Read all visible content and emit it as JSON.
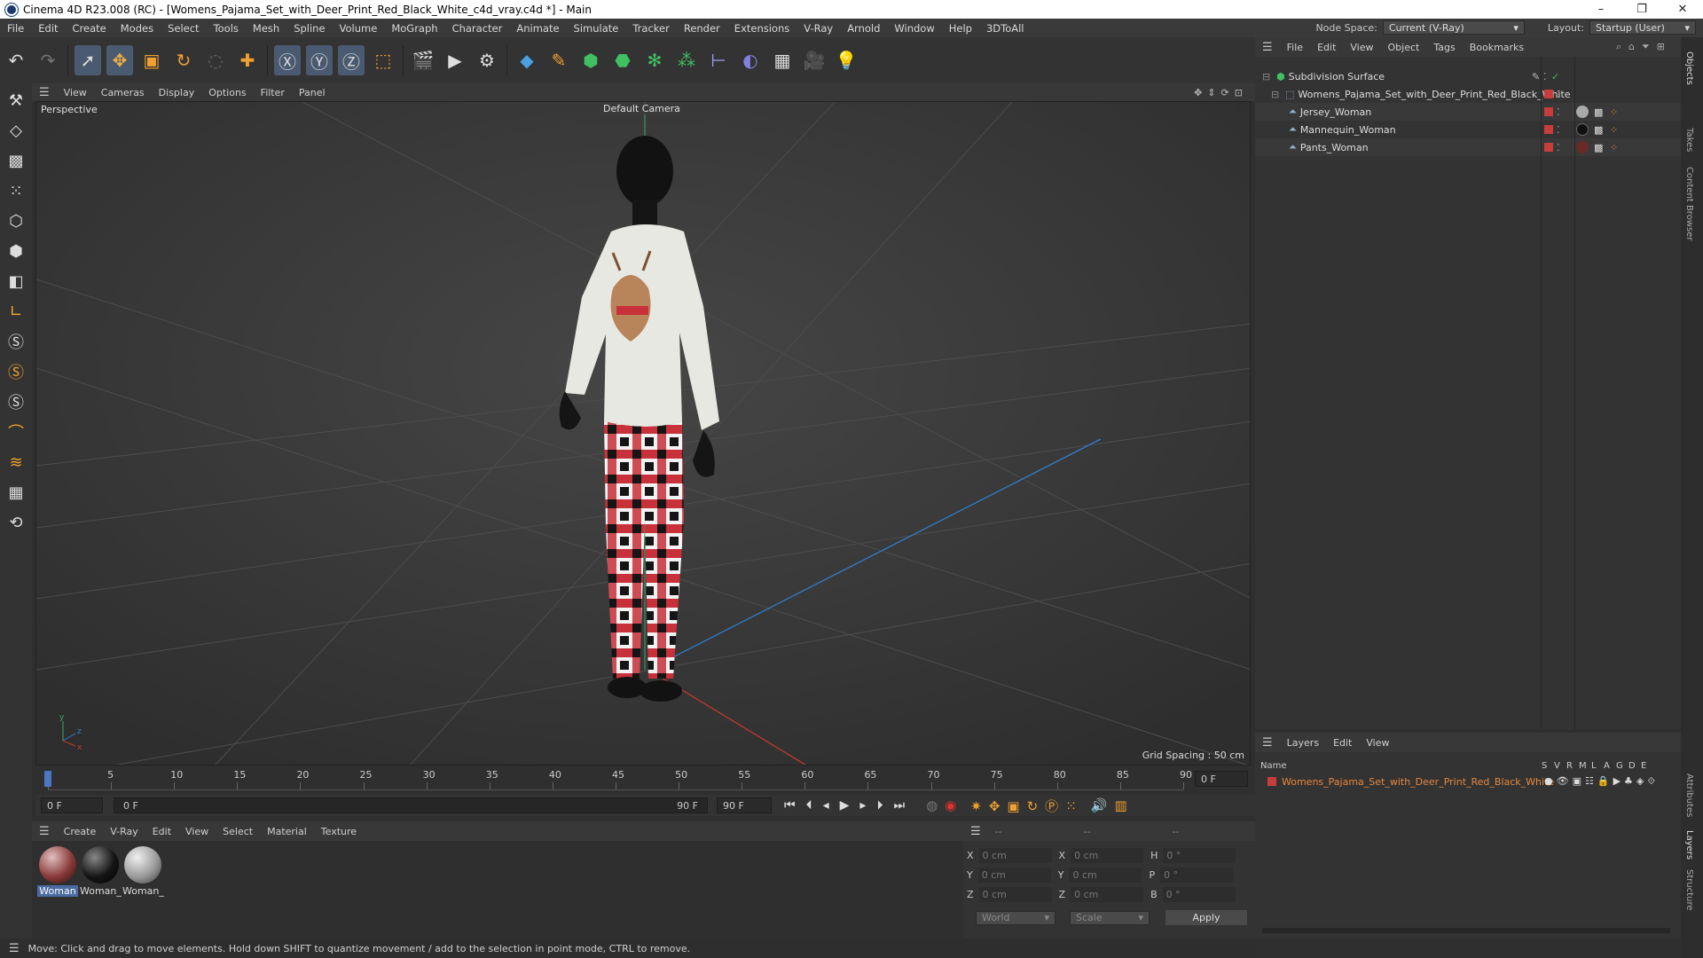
{
  "window": {
    "title": "Cinema 4D R23.008 (RC) - [Womens_Pajama_Set_with_Deer_Print_Red_Black_White_c4d_vray.c4d *] - Main",
    "min": "–",
    "max": "❐",
    "close": "✕"
  },
  "menu": {
    "items": [
      "File",
      "Edit",
      "Create",
      "Modes",
      "Select",
      "Tools",
      "Mesh",
      "Spline",
      "Volume",
      "MoGraph",
      "Character",
      "Animate",
      "Simulate",
      "Tracker",
      "Render",
      "Extensions",
      "V-Ray",
      "Arnold",
      "Window",
      "Help",
      "3DToAll"
    ],
    "node_space_label": "Node Space:",
    "node_space_value": "Current (V-Ray)",
    "layout_label": "Layout:",
    "layout_value": "Startup (User)"
  },
  "viewport": {
    "menu": [
      "View",
      "Cameras",
      "Display",
      "Options",
      "Filter",
      "Panel"
    ],
    "label": "Perspective",
    "camera": "Default Camera",
    "grid_spacing": "Grid Spacing : 50 cm"
  },
  "timeline": {
    "ticks": [
      "0",
      "5",
      "10",
      "15",
      "20",
      "25",
      "30",
      "35",
      "40",
      "45",
      "50",
      "55",
      "60",
      "65",
      "70",
      "75",
      "80",
      "85",
      "90"
    ],
    "end_frame": "0 F"
  },
  "transport": {
    "current": "0 F",
    "range_start": "0 F",
    "range_end": "90 F",
    "max": "90 F"
  },
  "materials": {
    "menu": [
      "Create",
      "V-Ray",
      "Edit",
      "View",
      "Select",
      "Material",
      "Texture"
    ],
    "items": [
      {
        "name": "Woman",
        "color": "#8a3a3a"
      },
      {
        "name": "Woman_",
        "color": "#151515"
      },
      {
        "name": "Woman_",
        "color": "#9a9a9a"
      }
    ]
  },
  "coords": {
    "headers": [
      "--",
      "--",
      "--"
    ],
    "rows": [
      {
        "a": "X",
        "av": "0 cm",
        "b": "X",
        "bv": "0 cm",
        "c": "H",
        "cv": "0 °"
      },
      {
        "a": "Y",
        "av": "0 cm",
        "b": "Y",
        "bv": "0 cm",
        "c": "P",
        "cv": "0 °"
      },
      {
        "a": "Z",
        "av": "0 cm",
        "b": "Z",
        "bv": "0 cm",
        "c": "B",
        "cv": "0 °"
      }
    ],
    "space": "World",
    "mode": "Scale",
    "apply": "Apply"
  },
  "status": "Move: Click and drag to move elements. Hold down SHIFT to quantize movement / add to the selection in point mode, CTRL to remove.",
  "objects": {
    "menu": [
      "File",
      "Edit",
      "View",
      "Object",
      "Tags",
      "Bookmarks"
    ],
    "tree": [
      {
        "name": "Subdivision Surface",
        "indent": 0
      },
      {
        "name": "Womens_Pajama_Set_with_Deer_Print_Red_Black_White",
        "indent": 1
      },
      {
        "name": "Jersey_Woman",
        "indent": 2
      },
      {
        "name": "Mannequin_Woman",
        "indent": 2
      },
      {
        "name": "Pants_Woman",
        "indent": 2
      }
    ]
  },
  "layers": {
    "menu": [
      "Layers",
      "Edit",
      "View"
    ],
    "header_name": "Name",
    "cols": [
      "S",
      "V",
      "R",
      "M",
      "L",
      "A",
      "G",
      "D",
      "E"
    ],
    "items": [
      "Womens_Pajama_Set_with_Deer_Print_Red_Black_White"
    ]
  },
  "sidetabs": [
    "Objects",
    "Takes",
    "Content Browser",
    "Attributes",
    "Layers",
    "Structure"
  ],
  "colors": {
    "accent": "#e8873a",
    "layer_red": "#c83c3c",
    "selection": "#4a5a70"
  }
}
